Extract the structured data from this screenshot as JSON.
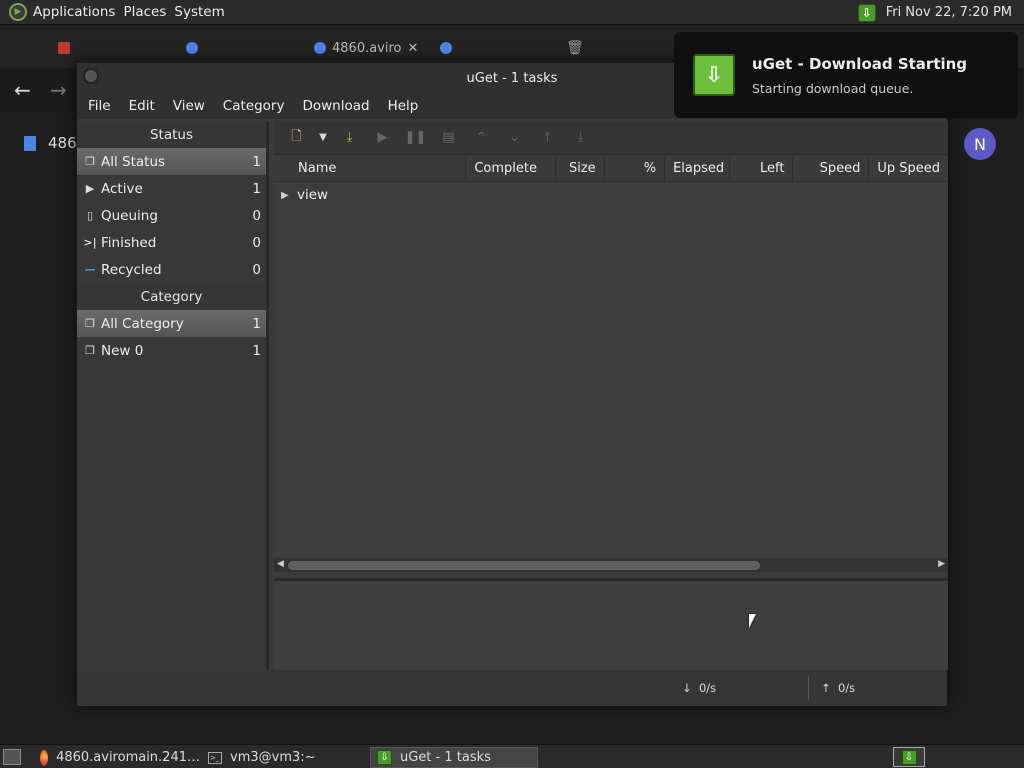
{
  "top_panel": {
    "menus": [
      "Applications",
      "Places",
      "System"
    ],
    "clock": "Fri Nov 22,  7:20 PM"
  },
  "browser": {
    "tabs": [
      {
        "label": "",
        "color": "#c0392b"
      },
      {
        "label": "",
        "color": "#4a86e8"
      },
      {
        "label": "4860.aviro",
        "color": "#4a86e8"
      },
      {
        "label": "",
        "color": "#4a86e8"
      }
    ],
    "doc_label": "486",
    "avatar": "N"
  },
  "uget": {
    "title": "uGet - 1 tasks",
    "menu": [
      "File",
      "Edit",
      "View",
      "Category",
      "Download",
      "Help"
    ],
    "sidebar": {
      "status_header": "Status",
      "status_items": [
        {
          "label": "All Status",
          "count": "1",
          "icon": "documents-icon"
        },
        {
          "label": "Active",
          "count": "1",
          "icon": "play-icon"
        },
        {
          "label": "Queuing",
          "count": "0",
          "icon": "document-icon"
        },
        {
          "label": "Finished",
          "count": "0",
          "icon": "finish-icon"
        },
        {
          "label": "Recycled",
          "count": "0",
          "icon": "minus-icon"
        }
      ],
      "category_header": "Category",
      "category_items": [
        {
          "label": "All Category",
          "count": "1"
        },
        {
          "label": "New 0",
          "count": "1"
        }
      ]
    },
    "columns": [
      "Name",
      "Complete",
      "Size",
      "%",
      "Elapsed",
      "Left",
      "Speed",
      "Up Speed"
    ],
    "tasks": [
      {
        "name": "view"
      }
    ],
    "status": {
      "down": "0/s",
      "up": "0/s"
    }
  },
  "notification": {
    "title": "uGet - Download Starting",
    "body": "Starting download queue."
  },
  "taskbar": {
    "items": [
      {
        "label": "4860.aviromain.241…"
      },
      {
        "label": "vm3@vm3:~"
      },
      {
        "label": "uGet - 1 tasks"
      }
    ]
  }
}
